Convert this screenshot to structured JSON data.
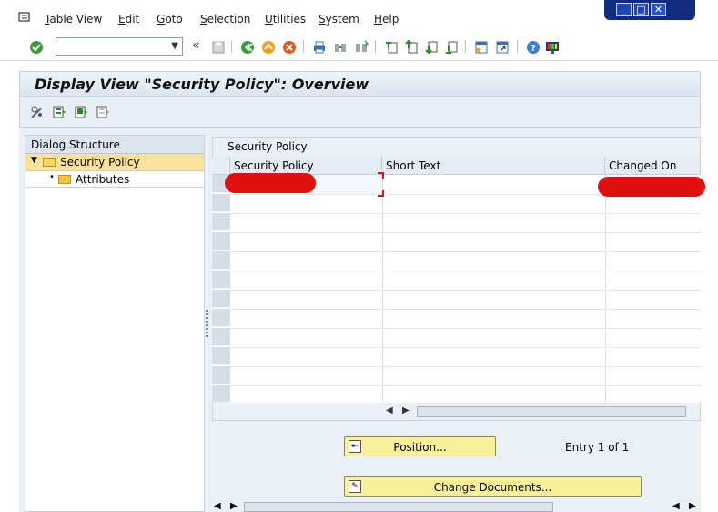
{
  "menubar": {
    "items": [
      {
        "label": "Table View",
        "underline": "T",
        "rest": "able View"
      },
      {
        "label": "Edit",
        "underline": "E",
        "rest": "dit"
      },
      {
        "label": "Goto",
        "underline": "G",
        "rest": "oto"
      },
      {
        "label": "Selection",
        "underline": "S",
        "rest": "election"
      },
      {
        "label": "Utilities",
        "underline": "U",
        "rest": "tilities"
      },
      {
        "label": "System",
        "underline": "S",
        "rest": "ystem"
      },
      {
        "label": "Help",
        "underline": "H",
        "rest": "elp"
      }
    ],
    "nav_back_glyph": "«"
  },
  "page": {
    "title": "Display View \"Security Policy\": Overview"
  },
  "dialog_structure": {
    "header": "Dialog Structure",
    "items": [
      {
        "label": "Security Policy",
        "selected": true,
        "expanded": true
      },
      {
        "label": "Attributes",
        "selected": false
      }
    ]
  },
  "table": {
    "panel_title": "Security Policy",
    "columns": [
      "Security Policy",
      "Short Text",
      "Changed On"
    ],
    "rows": [
      {
        "security_policy": "",
        "short_text": "",
        "changed_on": ""
      }
    ],
    "empty_rows": 11
  },
  "actions": {
    "position_label": "Position...",
    "change_documents_label": "Change Documents...",
    "entry_text": "Entry 1 of 1"
  },
  "colors": {
    "title_bar": "#dbe5f0",
    "selected_tree": "#fbe29a",
    "button_yellow": "#faf09a",
    "redaction": "#e01010"
  }
}
